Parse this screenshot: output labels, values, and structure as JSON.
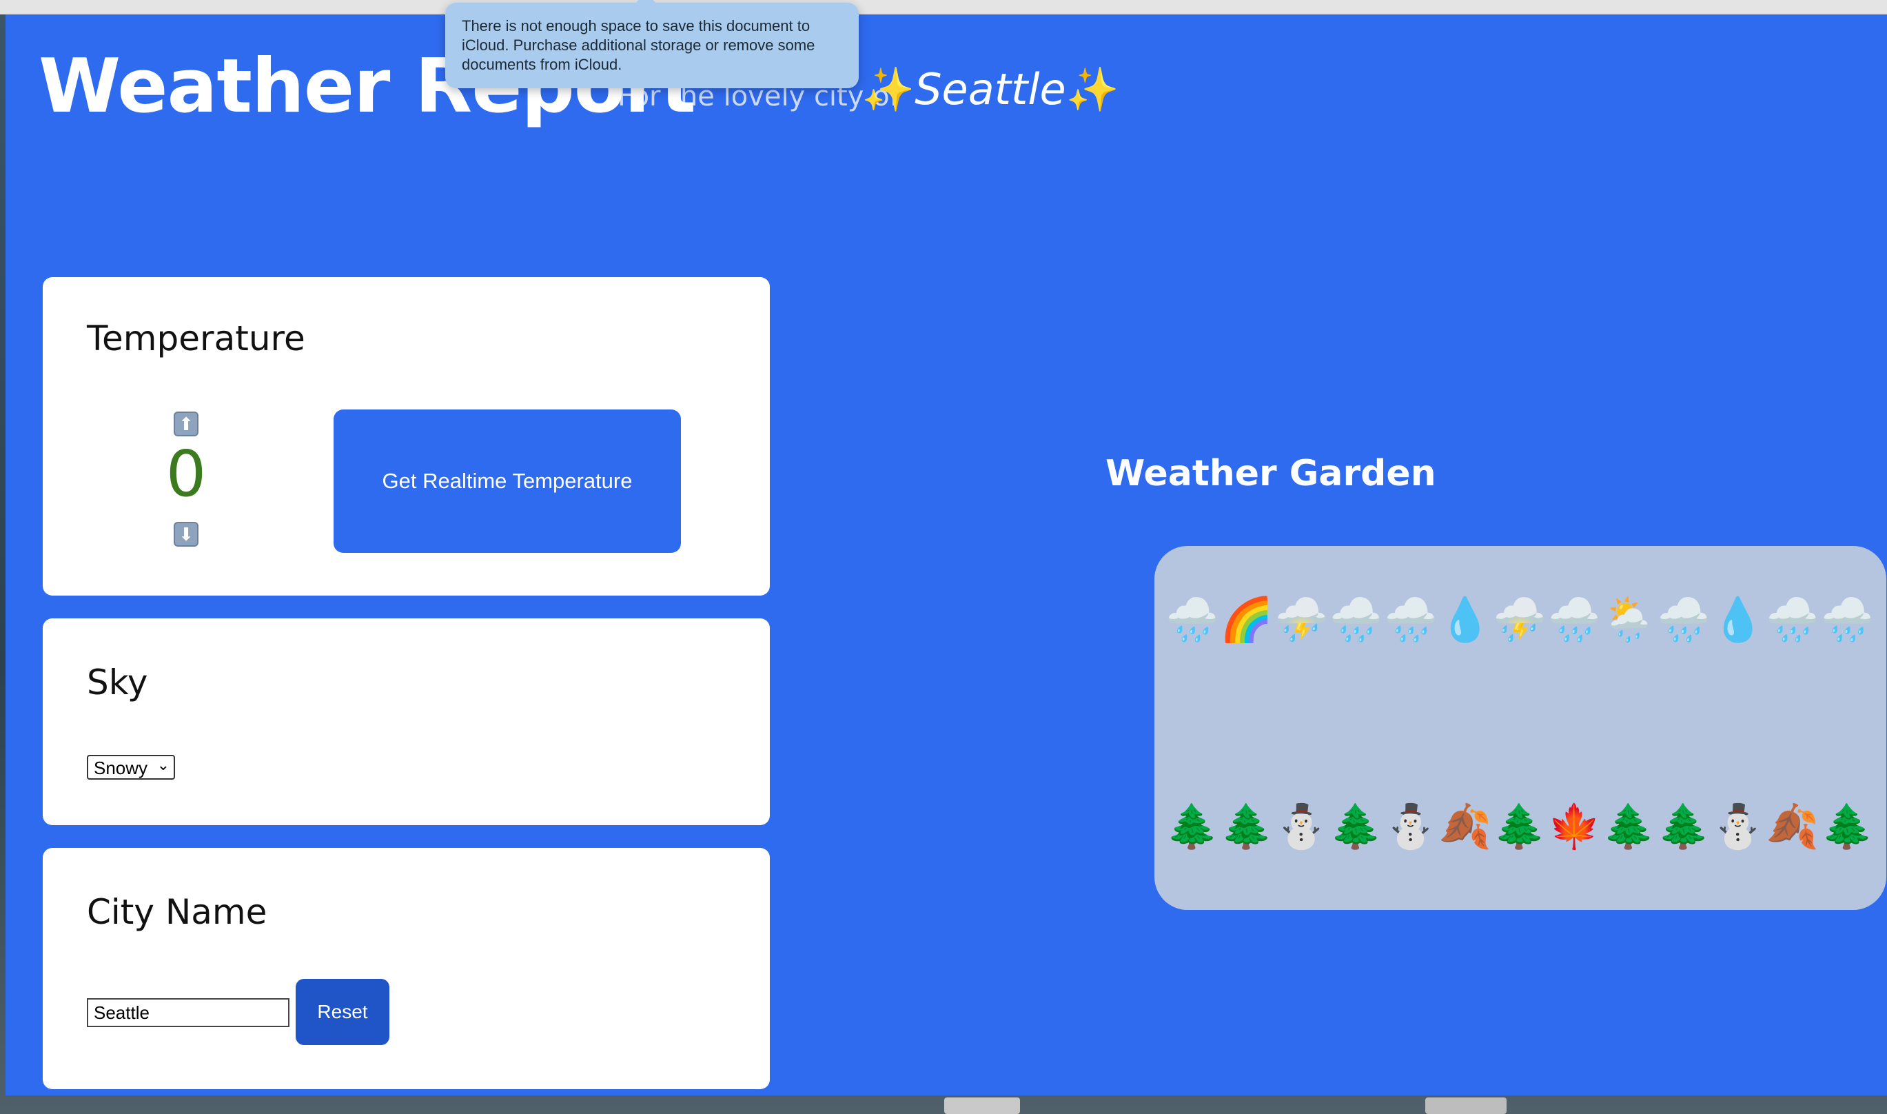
{
  "header": {
    "title": "Weather Report",
    "subtitle": "For the lovely city of",
    "sparkle": "✨",
    "city": "Seattle"
  },
  "tooltip": {
    "text": "There is not enough space to save this document to iCloud. Purchase additional storage or remove some documents from iCloud."
  },
  "temperature": {
    "title": "Temperature",
    "value": "0",
    "up_icon": "⬆",
    "down_icon": "⬇",
    "realtime_button": "Get Realtime Temperature",
    "value_color": "#3b7a1e"
  },
  "sky": {
    "title": "Sky",
    "selected": "Snowy",
    "chevron": "⌄"
  },
  "city_name": {
    "title": "City Name",
    "input_value": "Seattle",
    "reset_button": "Reset"
  },
  "garden": {
    "title": "Weather Garden",
    "sky_row": "🌧️🌈⛈️🌧️🌧️💧⛈️🌧️🌦️🌧️💧🌧️🌧️",
    "ground_row": "🌲🌲⛄🌲⛄🍂🌲🍁🌲🌲⛄🍂🌲"
  },
  "colors": {
    "page_background": "#2f6bef",
    "garden_background": "#b6c5df",
    "reset_button": "#2055c8"
  }
}
